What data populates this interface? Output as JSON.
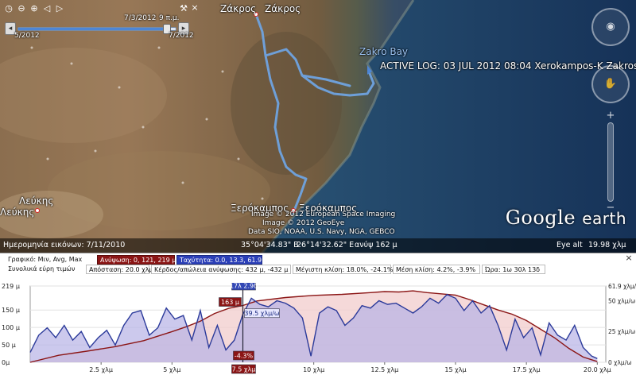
{
  "time_slider": {
    "current_date": "7/3/2012",
    "current_time": "9 π.μ.",
    "start_label": "5/2012",
    "end_label": "7/2012",
    "range_fraction": 0.96
  },
  "map": {
    "places": [
      {
        "label": "Ζάκρος",
        "id": "zakros-1"
      },
      {
        "label": "Ζάκρος",
        "id": "zakros-2"
      },
      {
        "label": "Zakro Bay",
        "id": "zakro-bay"
      },
      {
        "label": "Ξερόκαμπος",
        "id": "xerokampos-1"
      },
      {
        "label": "Ξερόκαμπος",
        "id": "xerokampos-2"
      },
      {
        "label": "Λεύκης",
        "id": "lefkis-1"
      },
      {
        "label": "Λεύκης",
        "id": "lefkis-2"
      }
    ],
    "active_log": "ACTIVE LOG: 03 JUL 2012 08:04 Xerokampos-K Zakros",
    "attribution": [
      "Image © 2012 European Space Imaging",
      "Image © 2012 GeoEye",
      "Data SIO, NOAA, U.S. Navy, NGA, GEBCO"
    ],
    "logo_google": "Google",
    "logo_earth": "earth",
    "track_color": "#6fa3e0"
  },
  "status_bar": {
    "imagery_date": "Ημερομηνία εικόνων: 7/11/2010",
    "coords": "35°04'34.83\" B",
    "lon": "26°14'32.62\" E",
    "elev": "ανύψ   162 μ",
    "eye_alt_label": "Eye alt",
    "eye_alt_value": "19.98 χλμ"
  },
  "panel": {
    "close": "×",
    "row1": {
      "label": "Γραφικό: Μιν, Avg, Max",
      "elevation": "Ανύψωση: 0, 121, 219 μ",
      "speed": "Ταχύτητα: 0.0, 13.3, 61.9 χλμ/ω"
    },
    "row2": {
      "label": "Συνολικά εύρη τιμών",
      "distance": "Απόσταση: 20.0 χλμ",
      "gain": "Κέρδος/απώλεια ανύψωσης: 432 μ, -432 μ",
      "max_slope": "Μέγιστη κλίση: 18.0%, -24.1%",
      "avg_slope": "Μέση κλίση: 4.2%, -3.9%",
      "time": "Ώρα: 1ω 30λ 13δ"
    },
    "cursor_time": "17λ 2.9δ",
    "cursor_elev": "163 μ",
    "cursor_speed": "39.5 χλμ/ω",
    "cursor_slope": "-4.3%",
    "cursor_dist": "7.5 χλμ"
  },
  "chart_data": {
    "type": "area",
    "x_unit": "χλμ",
    "xlim": [
      0,
      20.3
    ],
    "x_ticks": [
      {
        "v": 2.5,
        "label": "2.5 χλμ"
      },
      {
        "v": 5,
        "label": "5 χλμ"
      },
      {
        "v": 10,
        "label": "10 χλμ"
      },
      {
        "v": 12.5,
        "label": "12.5 χλμ"
      },
      {
        "v": 15,
        "label": "15 χλμ"
      },
      {
        "v": 17.5,
        "label": "17.5 χλμ"
      },
      {
        "v": 20,
        "label": "20.0 χλμ"
      }
    ],
    "left_axis": {
      "ylim": [
        0,
        219
      ],
      "ticks": [
        {
          "v": 219,
          "label": "219 μ"
        },
        {
          "v": 150,
          "label": "150 μ"
        },
        {
          "v": 100,
          "label": "100 μ"
        },
        {
          "v": 50,
          "label": "50 μ"
        },
        {
          "v": 0,
          "label": "0μ"
        }
      ]
    },
    "right_axis": {
      "ylim": [
        0,
        61.9
      ],
      "ticks": [
        {
          "v": 61.9,
          "label": "61.9 χλμ/ω"
        },
        {
          "v": 50,
          "label": "50 χλμ/ω"
        },
        {
          "v": 25,
          "label": "25 χλμ/ω"
        },
        {
          "v": 0,
          "label": "0 χλμ/ω"
        }
      ]
    },
    "series": [
      {
        "name": "Ανύψωση",
        "axis": "left",
        "color": "#8b1515",
        "fill": "#f2cccc",
        "x": [
          0,
          1,
          2,
          3,
          4,
          5,
          5.5,
          6,
          6.5,
          7,
          7.5,
          8,
          9,
          10,
          11,
          12,
          12.5,
          13,
          13.5,
          14,
          15,
          15.5,
          16,
          16.5,
          17,
          17.5,
          18,
          18.5,
          19,
          19.5,
          20
        ],
        "y": [
          0,
          20,
          32,
          45,
          62,
          88,
          102,
          118,
          140,
          155,
          163,
          176,
          186,
          192,
          195,
          200,
          203,
          202,
          205,
          200,
          193,
          180,
          165,
          150,
          138,
          120,
          95,
          70,
          40,
          15,
          2
        ]
      },
      {
        "name": "Ταχύτητα",
        "axis": "right",
        "color": "#2b3a9a",
        "fill": "#b7b2e6",
        "x": [
          0,
          0.3,
          0.6,
          0.9,
          1.2,
          1.5,
          1.8,
          2.1,
          2.4,
          2.7,
          3.0,
          3.3,
          3.6,
          3.9,
          4.2,
          4.5,
          4.8,
          5.1,
          5.4,
          5.7,
          6.0,
          6.3,
          6.6,
          6.9,
          7.2,
          7.5,
          7.8,
          8.1,
          8.4,
          8.7,
          9.0,
          9.3,
          9.6,
          9.9,
          10.2,
          10.5,
          10.8,
          11.1,
          11.4,
          11.7,
          12.0,
          12.3,
          12.6,
          12.9,
          13.2,
          13.5,
          13.8,
          14.1,
          14.4,
          14.7,
          15.0,
          15.3,
          15.6,
          15.9,
          16.2,
          16.5,
          16.8,
          17.1,
          17.4,
          17.7,
          18.0,
          18.3,
          18.6,
          18.9,
          19.2,
          19.5,
          19.8,
          20.0
        ],
        "y": [
          8,
          22,
          28,
          20,
          30,
          18,
          25,
          12,
          20,
          26,
          14,
          30,
          40,
          42,
          22,
          28,
          44,
          35,
          38,
          18,
          42,
          12,
          30,
          10,
          18,
          39,
          52,
          47,
          45,
          50,
          48,
          44,
          36,
          5,
          40,
          45,
          42,
          30,
          36,
          46,
          44,
          50,
          47,
          48,
          44,
          40,
          45,
          52,
          48,
          55,
          52,
          42,
          50,
          40,
          46,
          30,
          10,
          35,
          20,
          28,
          6,
          32,
          22,
          18,
          30,
          12,
          5,
          3
        ]
      }
    ],
    "cursor_x": 7.5
  }
}
